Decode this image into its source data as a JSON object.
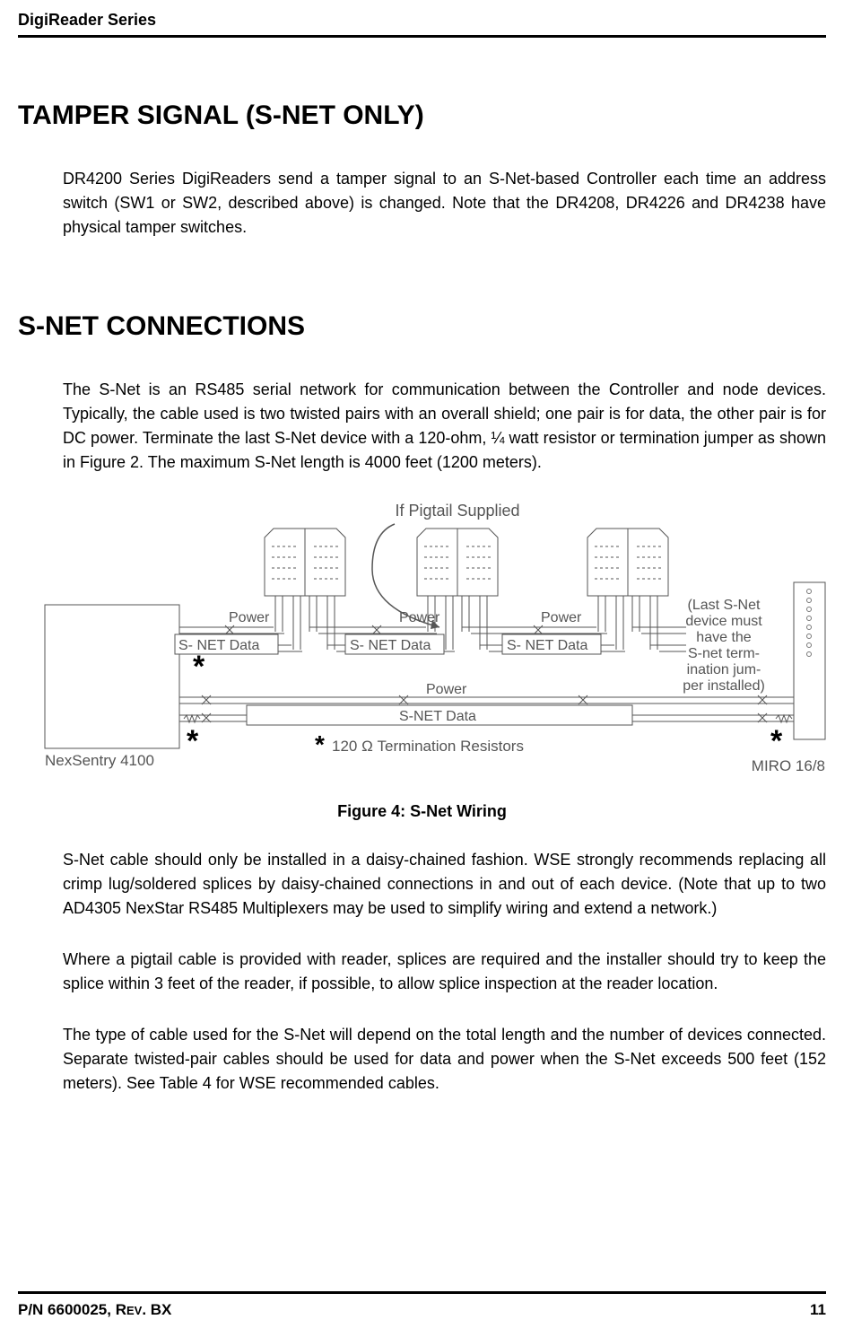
{
  "header": {
    "series": "DigiReader Series"
  },
  "sections": {
    "tamper": {
      "heading": "TAMPER SIGNAL (S-NET ONLY)",
      "para1": "DR4200 Series DigiReaders send a tamper signal to an S-Net-based Controller each time an address switch (SW1 or SW2, described above) is changed. Note that the DR4208, DR4226 and DR4238 have physical tamper switches."
    },
    "snet": {
      "heading": "S-NET CONNECTIONS",
      "para1": "The S-Net is an RS485 serial network for communication between the Controller and node devices. Typically, the cable used is two twisted pairs with an overall shield; one pair is for data, the other pair is for DC power.  Terminate the last S-Net device with a 120-ohm, ¼ watt resistor or termination jumper as shown in Figure 2.  The maximum S-Net length is 4000 feet (1200 meters).",
      "para2": "S-Net cable should only be installed in a daisy-chained fashion. WSE strongly recommends replacing all crimp lug/soldered splices by daisy-chained connections in and out of each device. (Note that up to two AD4305 NexStar RS485 Multiplexers may be used to simplify wiring and extend a network.)",
      "para3": "Where a pigtail cable is provided with reader, splices are required and the installer should try to keep the splice within 3 feet of the reader, if possible, to allow splice inspection at the reader location.",
      "para4": "The type of cable used for the S-Net will depend on the total length and the number of devices connected. Separate twisted-pair cables should be used for data and power when the S-Net exceeds 500 feet (152 meters).  See Table 4 for WSE recommended cables."
    }
  },
  "figure": {
    "caption": "Figure 4:  S-Net Wiring",
    "labels": {
      "pigtail": "If Pigtail Supplied",
      "power": "Power",
      "snet_data_inline": "S-  NET Data",
      "snet_data_inline2": "S- NET Data",
      "snet_data_inline3": "S- NET Data",
      "snet_data_bus": "S-NET Data",
      "last_device_note_l1": "(Last S-Net",
      "last_device_note_l2": "device must",
      "last_device_note_l3": "have the",
      "last_device_note_l4": "S-net term-",
      "last_device_note_l5": "ination jum-",
      "last_device_note_l6": "per installed)",
      "termination": "120 Ω Termination Resistors",
      "nexsentry": "NexSentry 4100",
      "miro": "MIRO 16/8",
      "star": "*"
    }
  },
  "footer": {
    "pn": "P/N 6600025, R",
    "rev": "EV",
    "bx": ". BX",
    "page": "11"
  }
}
